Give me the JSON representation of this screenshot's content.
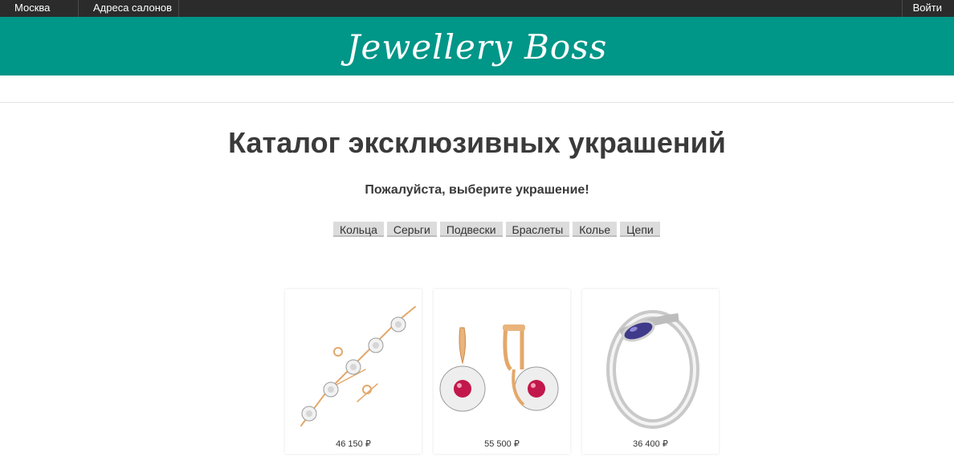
{
  "topbar": {
    "city": "Москва",
    "addresses": "Адреса салонов",
    "login": "Войти"
  },
  "brand": {
    "logo": "Jewellery Boss"
  },
  "page": {
    "title": "Каталог эксклюзивных украшений",
    "subtitle": "Пожалуйста, выберите украшение!"
  },
  "categories": [
    "Кольца",
    "Серьги",
    "Подвески",
    "Браслеты",
    "Колье",
    "Цепи"
  ],
  "products": [
    {
      "kind": "bracelet",
      "price": "46 150 ₽"
    },
    {
      "kind": "earrings",
      "price": "55 500 ₽"
    },
    {
      "kind": "ring",
      "price": "36 400 ₽"
    }
  ],
  "colors": {
    "topbar": "#2b2b2b",
    "brand": "#009688",
    "button": "#dcdcdc",
    "gold": "#e3a86a",
    "ruby": "#c2184b",
    "iolite": "#3f3b8a"
  }
}
